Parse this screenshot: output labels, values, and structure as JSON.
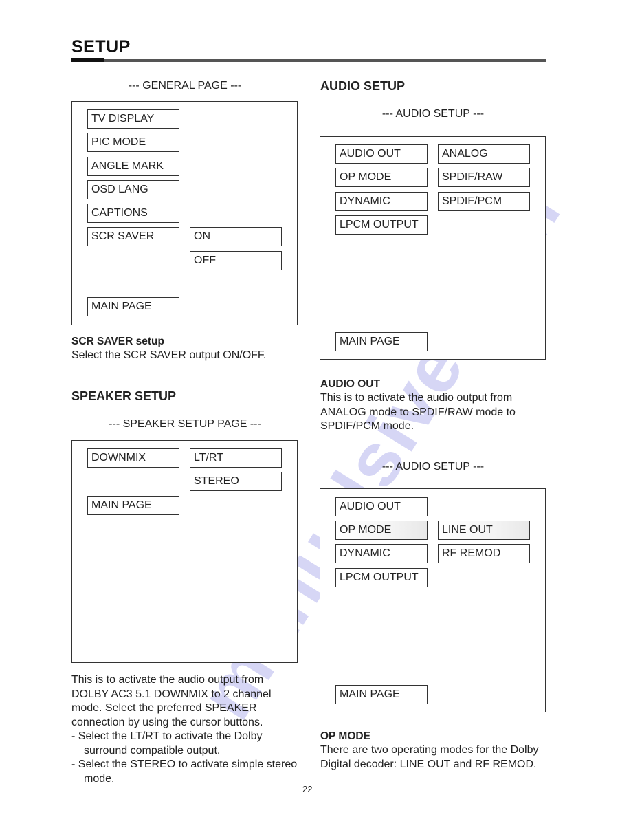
{
  "page": {
    "title": "SETUP",
    "page_number": "22",
    "watermark": "manualsive.com"
  },
  "general": {
    "caption": "--- GENERAL PAGE ---",
    "items": [
      "TV DISPLAY",
      "PIC MODE",
      "ANGLE MARK",
      "OSD LANG",
      "CAPTIONS",
      "SCR SAVER"
    ],
    "options": [
      "ON",
      "OFF"
    ],
    "main_page": "MAIN PAGE",
    "desc_heading": "SCR SAVER setup",
    "desc_text": "Select the SCR SAVER output ON/OFF."
  },
  "speaker": {
    "heading": "SPEAKER SETUP",
    "caption": "--- SPEAKER SETUP PAGE ---",
    "items": [
      "DOWNMIX"
    ],
    "options": [
      "LT/RT",
      "STEREO"
    ],
    "main_page": "MAIN PAGE",
    "desc_lines": [
      "This is to activate the audio output from",
      "DOLBY AC3 5.1 DOWNMIX to 2 channel",
      "mode.  Select the preferred SPEAKER",
      "connection by using the cursor buttons."
    ],
    "bullets": [
      "-  Select the LT/RT to activate the Dolby surround compatible output.",
      "-  Select the STEREO to activate simple stereo mode."
    ]
  },
  "audio": {
    "heading": "AUDIO SETUP",
    "screen1": {
      "caption": "--- AUDIO SETUP ---",
      "items": [
        "AUDIO OUT",
        "OP MODE",
        "DYNAMIC",
        "LPCM OUTPUT"
      ],
      "options": [
        "ANALOG",
        "SPDIF/RAW",
        "SPDIF/PCM"
      ],
      "main_page": "MAIN PAGE",
      "desc_heading": "AUDIO OUT",
      "desc_text": "This is to activate the audio output from ANALOG mode to SPDIF/RAW mode to SPDIF/PCM mode."
    },
    "screen2": {
      "caption": "--- AUDIO SETUP ---",
      "items": [
        "AUDIO OUT",
        "OP MODE",
        "DYNAMIC",
        "LPCM OUTPUT"
      ],
      "options": [
        "LINE OUT",
        "RF REMOD"
      ],
      "main_page": "MAIN PAGE",
      "desc_heading": "OP MODE",
      "desc_text": "There are two operating modes for the Dolby Digital decoder:  LINE OUT and RF REMOD."
    }
  }
}
